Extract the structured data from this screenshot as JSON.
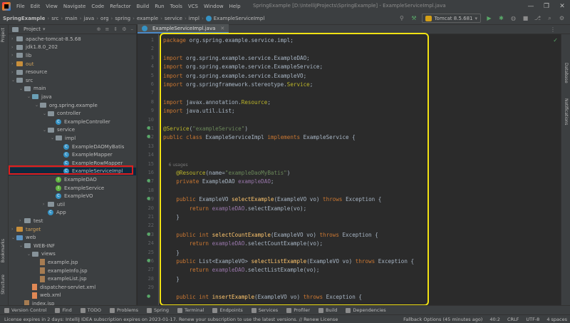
{
  "window": {
    "title": "SpringExample [D:\\IntelliJProjects\\SpringExample] - ExampleServiceImpl.java",
    "menu": [
      "File",
      "Edit",
      "View",
      "Navigate",
      "Code",
      "Refactor",
      "Build",
      "Run",
      "Tools",
      "VCS",
      "Window",
      "Help"
    ],
    "controls": [
      "—",
      "❐",
      "✕"
    ]
  },
  "breadcrumbs": [
    "SpringExample",
    "src",
    "main",
    "java",
    "org",
    "spring",
    "example",
    "service",
    "impl",
    "ExampleServiceImpl"
  ],
  "run_config": "Tomcat 8.5.681",
  "project_panel": {
    "title": "Project",
    "tree": [
      {
        "label": "apache-tomcat-8.5.68",
        "depth": 0,
        "icon": "folder-plain",
        "expanded": false
      },
      {
        "label": "jdk1.8.0_202",
        "depth": 0,
        "icon": "folder-plain",
        "expanded": false
      },
      {
        "label": "lib",
        "depth": 0,
        "icon": "folder-plain",
        "expanded": false
      },
      {
        "label": "out",
        "depth": 0,
        "icon": "folder-orange",
        "expanded": false
      },
      {
        "label": "resource",
        "depth": 0,
        "icon": "folder-plain",
        "expanded": false
      },
      {
        "label": "src",
        "depth": 0,
        "icon": "folder-plain",
        "expanded": true
      },
      {
        "label": "main",
        "depth": 1,
        "icon": "folder-plain",
        "expanded": true
      },
      {
        "label": "java",
        "depth": 2,
        "icon": "folder-src",
        "expanded": true
      },
      {
        "label": "org.spring.example",
        "depth": 3,
        "icon": "folder-plain",
        "expanded": true
      },
      {
        "label": "controller",
        "depth": 4,
        "icon": "folder-plain",
        "expanded": true
      },
      {
        "label": "ExampleController",
        "depth": 5,
        "icon": "class",
        "expanded": null
      },
      {
        "label": "service",
        "depth": 4,
        "icon": "folder-plain",
        "expanded": true
      },
      {
        "label": "impl",
        "depth": 5,
        "icon": "folder-plain",
        "expanded": true
      },
      {
        "label": "ExampleDAOMyBatis",
        "depth": 6,
        "icon": "class",
        "expanded": null
      },
      {
        "label": "ExampleMapper",
        "depth": 6,
        "icon": "class",
        "expanded": null
      },
      {
        "label": "ExampleRowMapper",
        "depth": 6,
        "icon": "class",
        "expanded": null
      },
      {
        "label": "ExampleServiceImpl",
        "depth": 6,
        "icon": "class",
        "expanded": null,
        "selected": true
      },
      {
        "label": "ExampleDAO",
        "depth": 5,
        "icon": "interface",
        "expanded": null
      },
      {
        "label": "ExampleService",
        "depth": 5,
        "icon": "interface",
        "expanded": null
      },
      {
        "label": "ExampleVO",
        "depth": 5,
        "icon": "class",
        "expanded": null
      },
      {
        "label": "util",
        "depth": 4,
        "icon": "folder-plain",
        "expanded": false
      },
      {
        "label": "App",
        "depth": 4,
        "icon": "class",
        "expanded": null
      },
      {
        "label": "test",
        "depth": 1,
        "icon": "folder-plain",
        "expanded": false
      },
      {
        "label": "target",
        "depth": 0,
        "icon": "folder-orange",
        "expanded": false
      },
      {
        "label": "web",
        "depth": 0,
        "icon": "folder-blue",
        "expanded": true
      },
      {
        "label": "WEB-INF",
        "depth": 1,
        "icon": "folder-plain",
        "expanded": true
      },
      {
        "label": "views",
        "depth": 2,
        "icon": "folder-plain",
        "expanded": true
      },
      {
        "label": "example.jsp",
        "depth": 3,
        "icon": "jsp",
        "expanded": null
      },
      {
        "label": "exampleInfo.jsp",
        "depth": 3,
        "icon": "jsp",
        "expanded": null
      },
      {
        "label": "exampleList.jsp",
        "depth": 3,
        "icon": "jsp",
        "expanded": null
      },
      {
        "label": "dispatcher-servlet.xml",
        "depth": 2,
        "icon": "xml",
        "expanded": null
      },
      {
        "label": "web.xml",
        "depth": 2,
        "icon": "xml",
        "expanded": null
      },
      {
        "label": "index.jsp",
        "depth": 1,
        "icon": "jsp",
        "expanded": null
      }
    ]
  },
  "editor": {
    "tab": "ExampleServiceImpl.java",
    "gutter_numbers": [
      "1",
      "2",
      "3",
      "4",
      "5",
      "6",
      "7",
      "8",
      "9",
      "10",
      "11",
      "12",
      "13",
      "14",
      "15",
      "16",
      "17",
      "18",
      "19",
      "20",
      "21",
      "22",
      "23",
      "24",
      "25",
      "26",
      "27",
      "28",
      "29"
    ],
    "lines": [
      [
        [
          "kw",
          "package "
        ],
        [
          "",
          "org.spring.example.service.impl;"
        ]
      ],
      [],
      [
        [
          "kw",
          "import "
        ],
        [
          "",
          "org.spring.example.service.ExampleDAO;"
        ]
      ],
      [
        [
          "kw",
          "import "
        ],
        [
          "",
          "org.spring.example.service.ExampleService;"
        ]
      ],
      [
        [
          "kw",
          "import "
        ],
        [
          "",
          "org.spring.example.service.ExampleVO;"
        ]
      ],
      [
        [
          "kw",
          "import "
        ],
        [
          "",
          "org.springframework.stereotype."
        ],
        [
          "ann",
          "Service"
        ],
        [
          "",
          ";"
        ]
      ],
      [],
      [
        [
          "kw",
          "import "
        ],
        [
          "",
          "javax.annotation."
        ],
        [
          "ann",
          "Resource"
        ],
        [
          "",
          ";"
        ]
      ],
      [
        [
          "kw",
          "import "
        ],
        [
          "",
          "java.util.List;"
        ]
      ],
      [],
      [
        [
          "ann",
          "@Service"
        ],
        [
          "",
          "("
        ],
        [
          "str",
          "\"exampleService\""
        ],
        [
          "",
          ")"
        ]
      ],
      [
        [
          "kw",
          "public class "
        ],
        [
          "",
          "ExampleServiceImpl "
        ],
        [
          "kw",
          "implements "
        ],
        [
          "",
          "ExampleService {"
        ]
      ],
      [],
      [],
      [
        [
          "hint",
          "    6 usages"
        ]
      ],
      [
        [
          "",
          "    "
        ],
        [
          "ann",
          "@Resource"
        ],
        [
          "",
          "(name="
        ],
        [
          "str",
          "\"exampleDaoMyBatis\""
        ],
        [
          "",
          ")"
        ]
      ],
      [
        [
          "",
          "    "
        ],
        [
          "kw",
          "private "
        ],
        [
          "",
          "ExampleDAO "
        ],
        [
          "fld",
          "exampleDAO"
        ],
        [
          "",
          ";"
        ]
      ],
      [],
      [
        [
          "",
          "    "
        ],
        [
          "kw",
          "public "
        ],
        [
          "",
          "ExampleVO "
        ],
        [
          "fn",
          "selectExample"
        ],
        [
          "",
          "(ExampleVO vo) "
        ],
        [
          "kw",
          "throws "
        ],
        [
          "",
          "Exception {"
        ]
      ],
      [
        [
          "",
          "        "
        ],
        [
          "kw",
          "return "
        ],
        [
          "fld",
          "exampleDAO"
        ],
        [
          "",
          ".selectExample(vo);"
        ]
      ],
      [
        [
          "",
          "    }"
        ]
      ],
      [],
      [
        [
          "",
          "    "
        ],
        [
          "kw",
          "public int "
        ],
        [
          "fn",
          "selectCountExample"
        ],
        [
          "",
          "(ExampleVO vo) "
        ],
        [
          "kw",
          "throws "
        ],
        [
          "",
          "Exception {"
        ]
      ],
      [
        [
          "",
          "        "
        ],
        [
          "kw",
          "return "
        ],
        [
          "fld",
          "exampleDAO"
        ],
        [
          "",
          ".selectCountExample(vo);"
        ]
      ],
      [
        [
          "",
          "    }"
        ]
      ],
      [
        [
          "",
          "    "
        ],
        [
          "kw",
          "public "
        ],
        [
          "",
          "List<ExampleVO> "
        ],
        [
          "fn",
          "selectListExample"
        ],
        [
          "",
          "(ExampleVO vo) "
        ],
        [
          "kw",
          "throws "
        ],
        [
          "",
          "Exception {"
        ]
      ],
      [
        [
          "",
          "        "
        ],
        [
          "kw",
          "return "
        ],
        [
          "fld",
          "exampleDAO"
        ],
        [
          "",
          ".selectListExample(vo);"
        ]
      ],
      [
        [
          "",
          "    }"
        ]
      ],
      [],
      [
        [
          "",
          "    "
        ],
        [
          "kw",
          "public int "
        ],
        [
          "fn",
          "insertExample"
        ],
        [
          "",
          "(ExampleVO vo) "
        ],
        [
          "kw",
          "throws "
        ],
        [
          "",
          "Exception {"
        ]
      ]
    ]
  },
  "right_stripe": [
    "Database",
    "Notifications"
  ],
  "left_stripe": [
    "Project",
    "Bookmarks",
    "Structure"
  ],
  "bottom_tools": [
    "Version Control",
    "Find",
    "TODO",
    "Problems",
    "Spring",
    "Terminal",
    "Endpoints",
    "Services",
    "Profiler",
    "Build",
    "Dependencies"
  ],
  "status": {
    "message": "License expires in 2 days: IntelliJ IDEA subscription expires on 2023-01-17. Renew your subscription to use the latest versions. // Renew License",
    "fallback": "Fallback Options (45 minutes ago)",
    "position": "40:2",
    "line_sep": "CRLF",
    "encoding": "UTF-8",
    "indent": "4 spaces"
  },
  "colors": {
    "highlight_box": "#f1e213",
    "selection_box": "#e01e1e"
  }
}
